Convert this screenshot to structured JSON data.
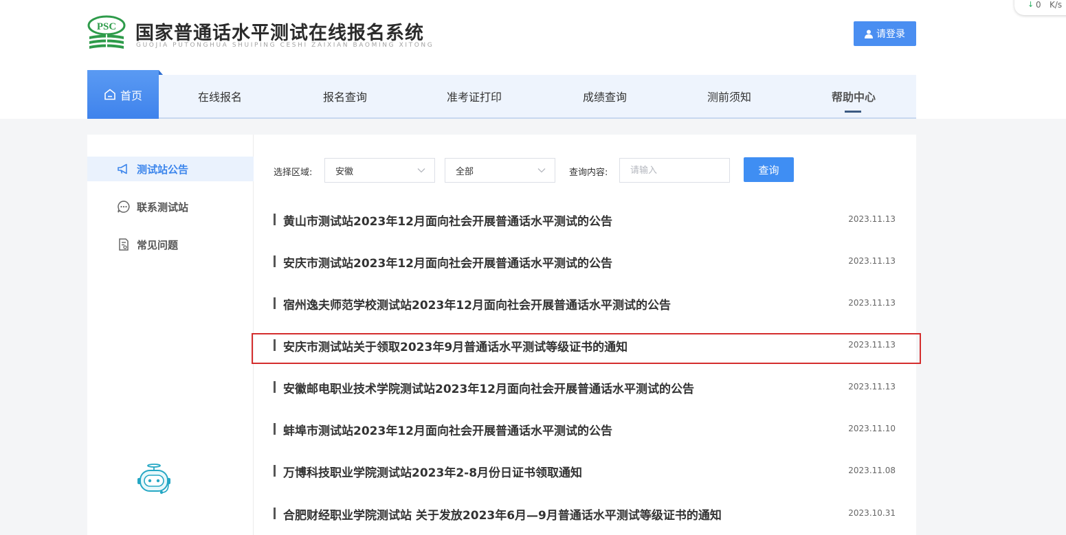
{
  "header": {
    "title": "国家普通话水平测试在线报名系统",
    "subtitle": "GUOJIA PUTONGHUA SHUIPING CESHI ZAIXIAN BAOMING XITONG",
    "logo_text": "PSC",
    "login_label": "请登录",
    "login_icon": "user-icon"
  },
  "net_speed": {
    "value": "0",
    "unit": "K/s"
  },
  "nav": {
    "items": [
      {
        "label": "首页",
        "icon": "home-icon"
      },
      {
        "label": "在线报名"
      },
      {
        "label": "报名查询"
      },
      {
        "label": "准考证打印"
      },
      {
        "label": "成绩查询"
      },
      {
        "label": "测前须知"
      },
      {
        "label": "帮助中心"
      }
    ]
  },
  "sidebar": {
    "items": [
      {
        "label": "测试站公告",
        "icon": "megaphone-icon"
      },
      {
        "label": "联系测试站",
        "icon": "chat-icon"
      },
      {
        "label": "常见问题",
        "icon": "document-icon"
      }
    ]
  },
  "filters": {
    "region_label": "选择区域:",
    "province": "安徽",
    "city": "全部",
    "query_label": "查询内容:",
    "query_placeholder": "请输入",
    "query_button": "查询"
  },
  "notices": [
    {
      "title": "黄山市测试站2023年12月面向社会开展普通话水平测试的公告",
      "date": "2023.11.13"
    },
    {
      "title": "安庆市测试站2023年12月面向社会开展普通话水平测试的公告",
      "date": "2023.11.13"
    },
    {
      "title": "宿州逸夫师范学校测试站2023年12月面向社会开展普通话水平测试的公告",
      "date": "2023.11.13"
    },
    {
      "title": "安庆市测试站关于领取2023年9月普通话水平测试等级证书的通知",
      "date": "2023.11.13"
    },
    {
      "title": "安徽邮电职业技术学院测试站2023年12月面向社会开展普通话水平测试的公告",
      "date": "2023.11.13"
    },
    {
      "title": "蚌埠市测试站2023年12月面向社会开展普通话水平测试的公告",
      "date": "2023.11.10"
    },
    {
      "title": "万博科技职业学院测试站2023年2-8月份日证书领取通知",
      "date": "2023.11.08"
    },
    {
      "title": "合肥财经职业学院测试站 关于发放2023年6月—9月普通话水平测试等级证书的通知",
      "date": "2023.10.31"
    }
  ],
  "colors": {
    "accent": "#3f8ef3",
    "logo_green": "#2e9b4a",
    "highlight": "#d42c2c"
  }
}
